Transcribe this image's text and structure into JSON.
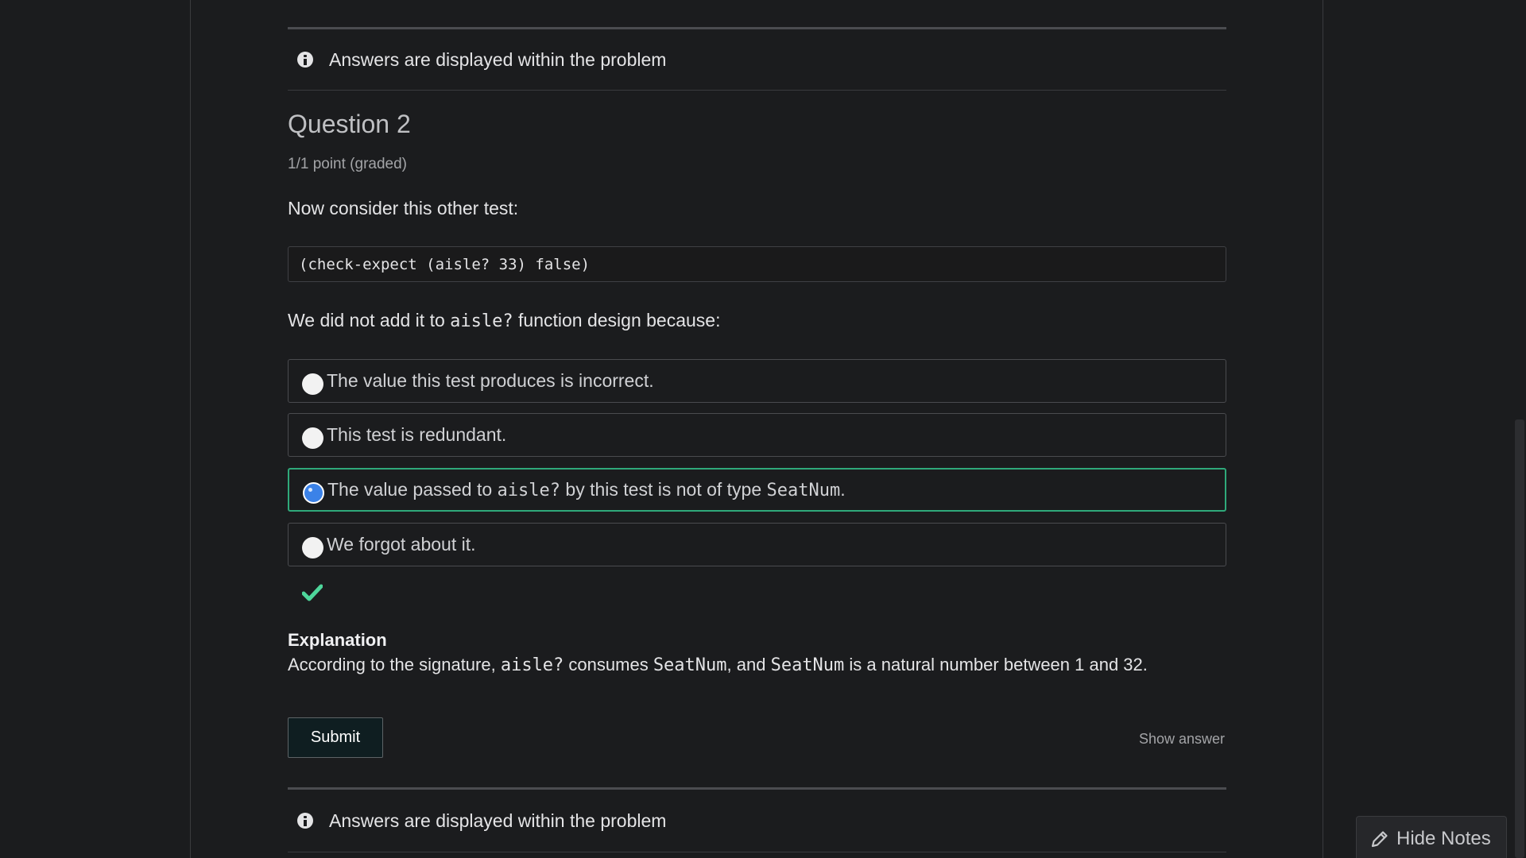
{
  "notice": {
    "text": "Answers are displayed within the problem",
    "icon": "info-icon"
  },
  "question": {
    "title": "Question 2",
    "points": "1/1 point (graded)",
    "prompt": "Now consider this other test:",
    "code": "(check-expect (aisle? 33) false)",
    "stem_before": "We did not add it to ",
    "stem_code": "aisle?",
    "stem_after": " function design because:"
  },
  "options": [
    {
      "before": "The value this test produces is incorrect.",
      "code": "",
      "middle": "",
      "code2": "",
      "after": "",
      "selected": false
    },
    {
      "before": "This test is redundant.",
      "code": "",
      "middle": "",
      "code2": "",
      "after": "",
      "selected": false
    },
    {
      "before": "The value passed to ",
      "code": "aisle?",
      "middle": " by this test is not of type ",
      "code2": "SeatNum",
      "after": ".",
      "selected": true
    },
    {
      "before": "We forgot about it.",
      "code": "",
      "middle": "",
      "code2": "",
      "after": "",
      "selected": false
    }
  ],
  "result": {
    "status": "correct",
    "icon": "checkmark-icon",
    "color": "#4ed69b"
  },
  "explanation": {
    "title": "Explanation",
    "t1": "According to the signature, ",
    "c1": "aisle?",
    "t2": " consumes ",
    "c2": "SeatNum",
    "t3": ", and ",
    "c3": "SeatNum",
    "t4": " is a natural number between 1 and 32."
  },
  "actions": {
    "submit_label": "Submit",
    "show_answer_label": "Show answer"
  },
  "notes": {
    "hide_label": "Hide Notes",
    "icon": "pencil-icon"
  },
  "colors": {
    "background": "#1b1c1e",
    "selected_border": "#2fa97a",
    "radio_selected": "#3b82e8",
    "submit_bg": "#0f1e21"
  }
}
